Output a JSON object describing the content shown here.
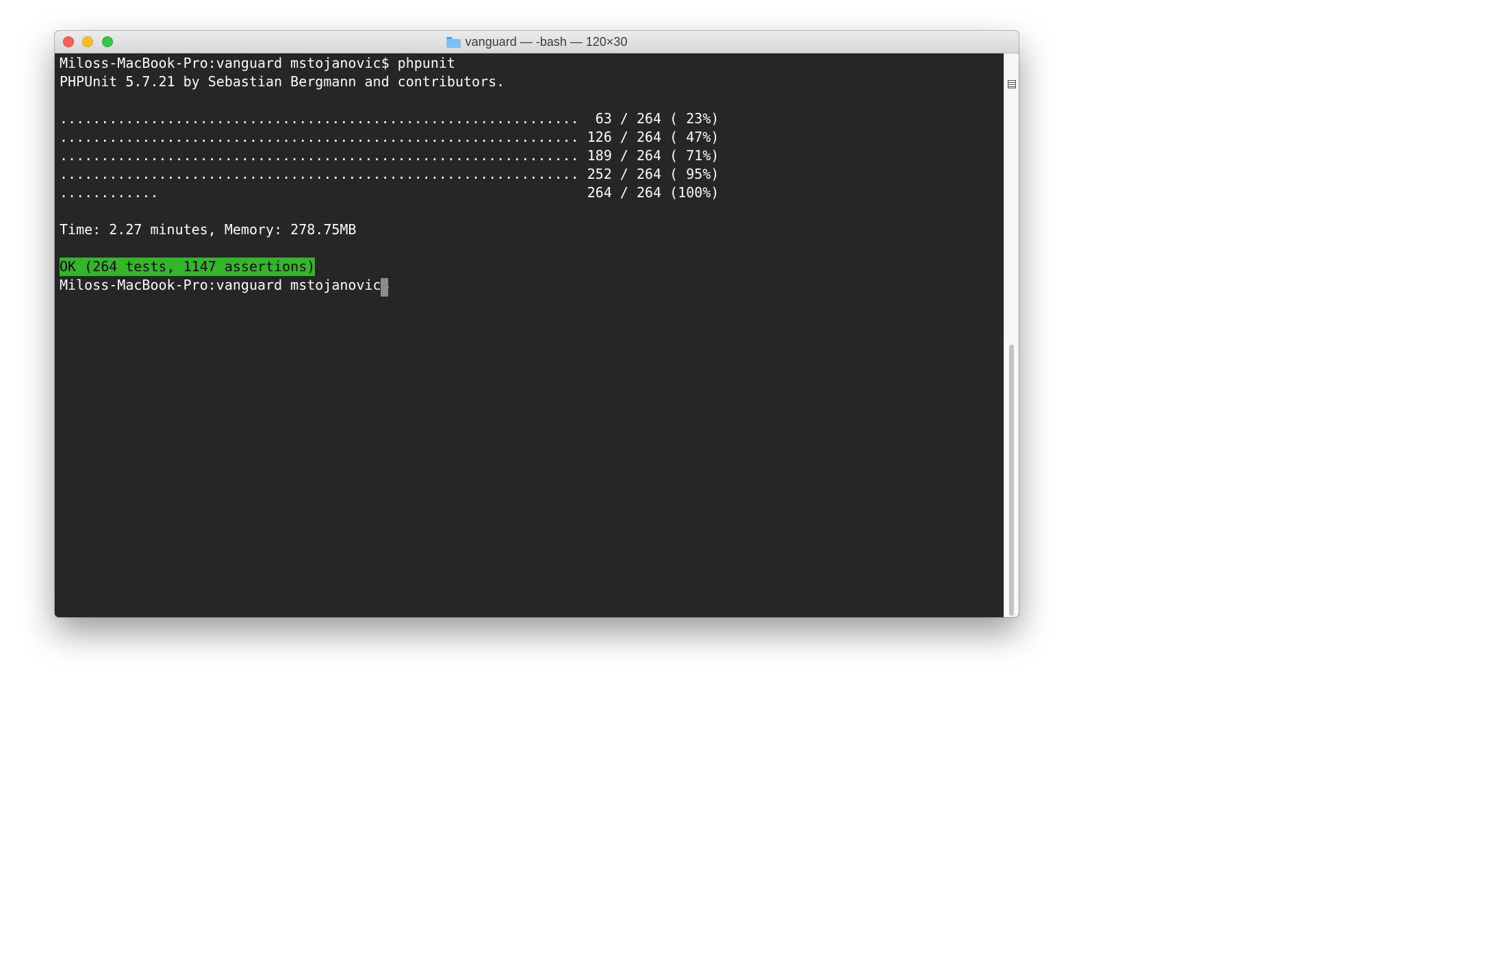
{
  "window": {
    "title": "vanguard — -bash — 120×30"
  },
  "terminal": {
    "lines": [
      "Miloss-MacBook-Pro:vanguard mstojanovic$ phpunit",
      "PHPUnit 5.7.21 by Sebastian Bergmann and contributors.",
      "",
      "...............................................................  63 / 264 ( 23%)",
      "............................................................... 126 / 264 ( 47%)",
      "............................................................... 189 / 264 ( 71%)",
      "............................................................... 252 / 264 ( 95%)",
      "............                                                    264 / 264 (100%)",
      "",
      "Time: 2.27 minutes, Memory: 278.75MB",
      "",
      "OK (264 tests, 1147 assertions)",
      "Miloss-MacBook-Pro:vanguard mstojanovic$ "
    ]
  },
  "colors": {
    "terminal_background": "#262626",
    "terminal_text": "#ffffff",
    "ok_highlight": "#33b629",
    "close_button": "#fc5f57",
    "minimize_button": "#fdbc2e",
    "zoom_button": "#33c748"
  },
  "icons": {
    "title_folder": "folder-icon",
    "split_pane": "split-pane-icon"
  }
}
